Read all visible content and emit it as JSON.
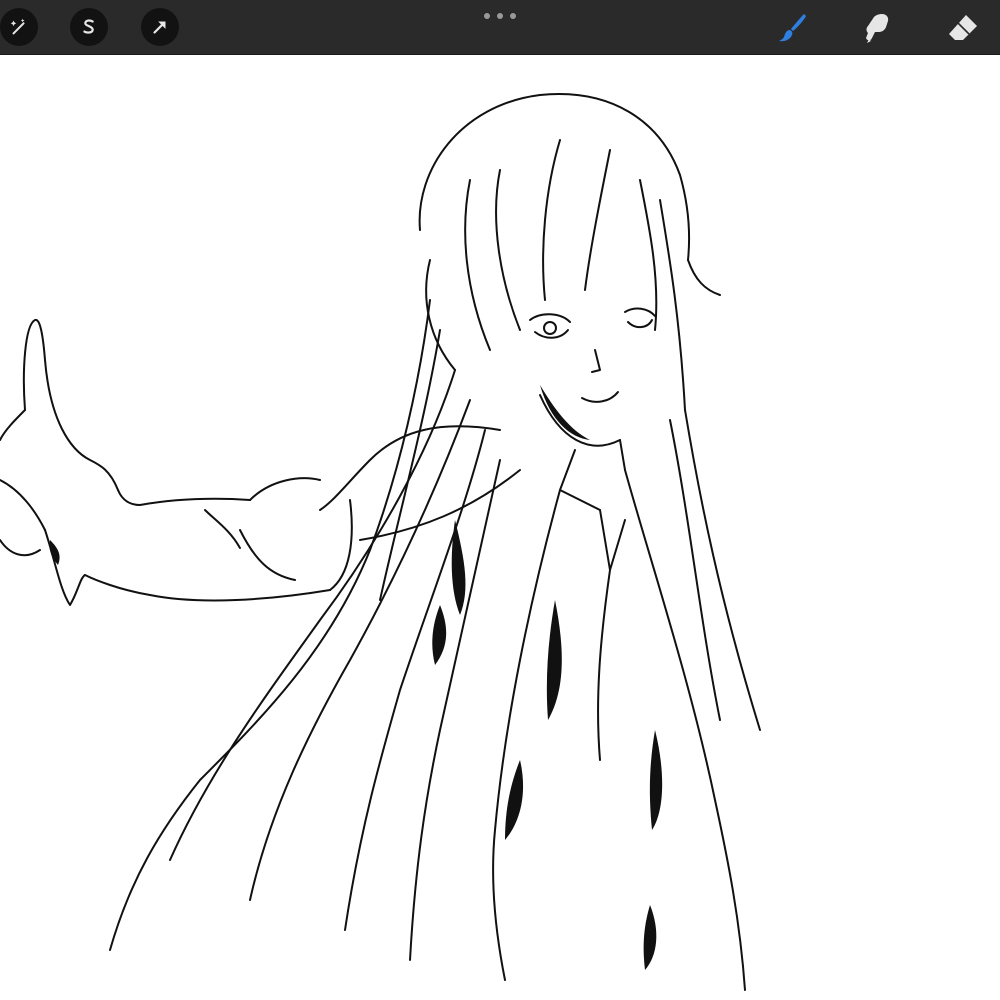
{
  "app": {
    "toolbar_bg": "#2a2a2a",
    "active_tool_color": "#2f7fe0",
    "inactive_tool_color": "#e6e6e6"
  },
  "toolbar": {
    "left_tools": [
      {
        "id": "adjustments",
        "icon": "magic-wand-icon"
      },
      {
        "id": "selection",
        "icon": "selection-s-icon"
      },
      {
        "id": "transform",
        "icon": "transform-arrow-icon"
      }
    ],
    "more_menu_icon": "more-dots-icon",
    "right_tools": [
      {
        "id": "brush",
        "icon": "paintbrush-icon",
        "active": true
      },
      {
        "id": "smudge",
        "icon": "smudge-finger-icon",
        "active": false
      },
      {
        "id": "eraser",
        "icon": "eraser-icon",
        "active": false
      }
    ]
  },
  "canvas": {
    "background": "#ffffff",
    "content": "line-art-sketch"
  }
}
